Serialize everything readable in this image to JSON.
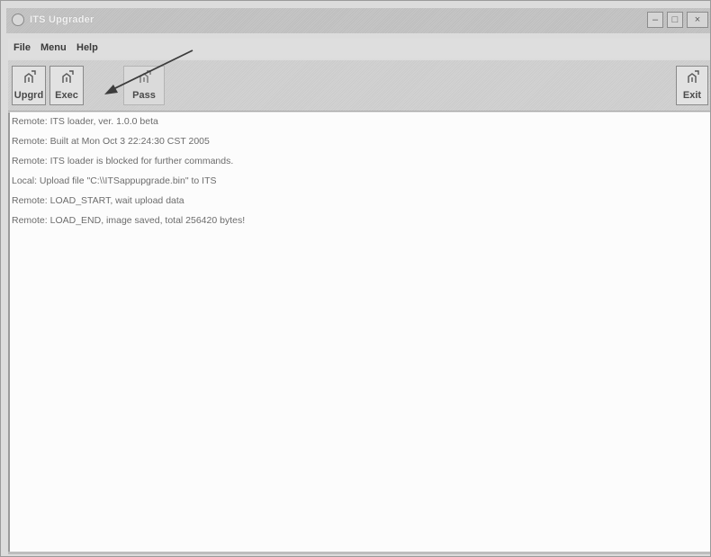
{
  "window": {
    "title": "ITS Upgrader",
    "min_glyph": "–",
    "max_glyph": "□",
    "close_glyph": "×"
  },
  "menu": {
    "file": "File",
    "menu": "Menu",
    "help": "Help"
  },
  "toolbar": {
    "upgrd_label": "Upgrd",
    "exec_label": "Exec",
    "pass_label": "Pass",
    "exit_label": "Exit"
  },
  "log": {
    "lines": [
      "Remote: ITS loader, ver. 1.0.0 beta",
      "Remote: Built at Mon Oct  3 22:24:30 CST 2005",
      "Remote: ITS loader is blocked for further commands.",
      "Local: Upload file \"C:\\\\ITSappupgrade.bin\" to ITS",
      "Remote: LOAD_START, wait upload data",
      "Remote: LOAD_END, image saved, total 256420 bytes!"
    ]
  },
  "icons": {
    "app": "app-icon",
    "tool": "plug-icon"
  }
}
